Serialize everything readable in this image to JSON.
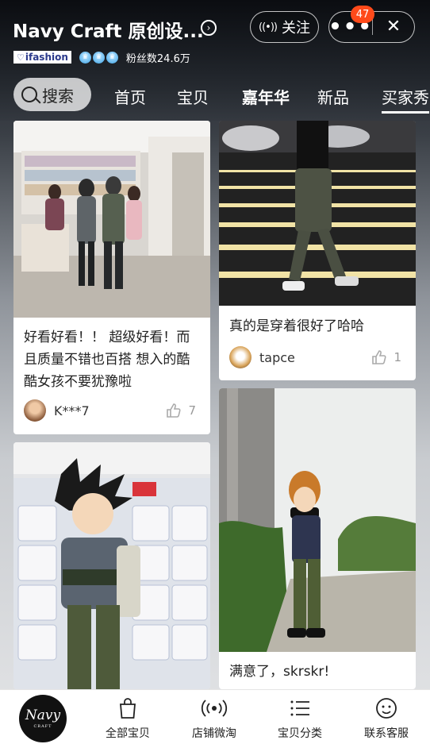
{
  "header": {
    "shop_title": "Navy Craft 原创设...",
    "ifashion_label": "ifashion",
    "fans_label": "粉丝数24.6万",
    "follow_label": "关注",
    "more_icon": "more-dots-icon",
    "close_icon": "close-icon",
    "notification_count": "47"
  },
  "tabs": {
    "search_label": "搜索",
    "items": [
      "首页",
      "宝贝",
      "嘉年华",
      "新品",
      "买家秀"
    ],
    "active": "买家秀"
  },
  "feed": [
    {
      "caption": "好看好看！！ 超级好看！而且质量不错也百搭 想入的酷酷女孩不要犹豫啦",
      "user": "K***7",
      "likes": "7"
    },
    {
      "caption": "真的是穿着很好了哈哈",
      "user": "tapce",
      "likes": "1"
    },
    {
      "caption": "",
      "user": "",
      "likes": ""
    },
    {
      "caption": "满意了，skrskr!",
      "user": "",
      "likes": ""
    }
  ],
  "bottom_nav": {
    "logo_text": "Navy",
    "logo_sub": "CRAFT",
    "items": [
      {
        "label": "全部宝贝",
        "icon": "shopping-bag-icon"
      },
      {
        "label": "店铺微淘",
        "icon": "broadcast-icon"
      },
      {
        "label": "宝贝分类",
        "icon": "list-icon"
      },
      {
        "label": "联系客服",
        "icon": "chat-face-icon"
      }
    ]
  },
  "colors": {
    "badge": "#ff4a1a",
    "header_bg": "#16191e",
    "card_bg": "#ffffff"
  }
}
